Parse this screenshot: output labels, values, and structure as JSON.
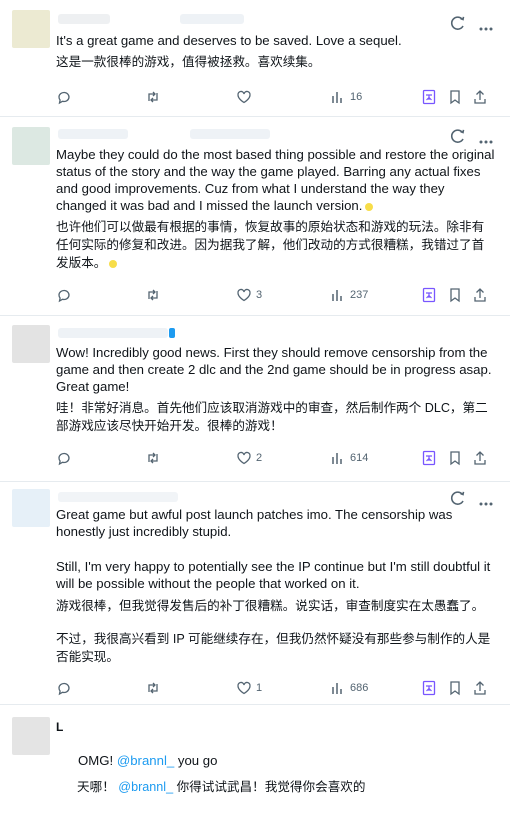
{
  "posts": [
    {
      "text_en": "It's a great game and deserves to be saved. Love a sequel.",
      "text_zh": "这是一款很棒的游戏，值得被拯救。喜欢续集。",
      "replies": "",
      "reposts": "",
      "likes": "",
      "views": "16"
    },
    {
      "text_en": "Maybe they could do the most based thing possible and restore the original status of the story and the way the game played. Barring any actual fixes and good improvements. Cuz from what I understand the way they changed it was bad and I missed the launch version.",
      "text_zh": "也许他们可以做最有根据的事情，恢复故事的原始状态和游戏的玩法。除非有任何实际的修复和改进。因为据我了解，他们改动的方式很糟糕，我错过了首发版本。",
      "replies": "",
      "reposts": "",
      "likes": "3",
      "views": "237"
    },
    {
      "text_en": "Wow! Incredibly good news. First they should remove censorship from the game and then create 2 dlc and the 2nd game should be in progress asap. Great game!",
      "text_zh": "哇！非常好消息。首先他们应该取消游戏中的审查，然后制作两个 DLC，第二部游戏应该尽快开始开发。很棒的游戏！",
      "replies": "",
      "reposts": "",
      "likes": "2",
      "views": "614"
    },
    {
      "text_en_1": "Great game but awful post launch patches imo. The censorship was honestly just incredibly stupid.",
      "text_en_2": "Still, I'm very happy to potentially see the IP continue but I'm still doubtful it will be possible without the people that worked on it.",
      "text_zh_1": "游戏很棒，但我觉得发售后的补丁很糟糕。说实话，审查制度实在太愚蠢了。",
      "text_zh_2": "不过，我很高兴看到 IP 可能继续存在，但我仍然怀疑没有那些参与制作的人是否能实现。",
      "replies": "",
      "reposts": "",
      "likes": "1",
      "views": "686"
    },
    {
      "author_initial": "L",
      "en_pre": "OMG! ",
      "en_mention": "@brannl_",
      "en_post": " you go",
      "zh_pre": "天哪！ ",
      "zh_mention": "@brannl_",
      "zh_post": " 你得试试武昌！我觉得你会喜欢的"
    }
  ],
  "icons": {
    "reply": "reply-icon",
    "repost": "repost-icon",
    "like": "heart-icon",
    "views": "views-icon",
    "translate": "translate-icon",
    "bookmark": "bookmark-icon",
    "share": "share-icon",
    "more": "more-icon"
  },
  "colors": {
    "accent": "#1d9bf0",
    "muted": "#536471",
    "translate": "#7856ff"
  }
}
